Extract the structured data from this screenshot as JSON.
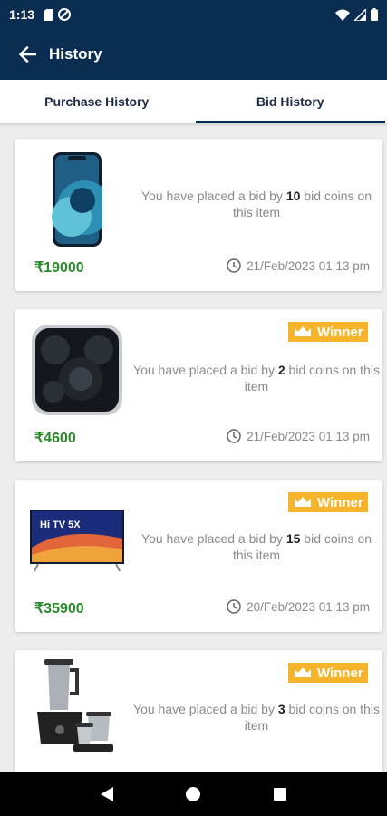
{
  "status_bar": {
    "time": "1:13"
  },
  "app_bar": {
    "title": "History"
  },
  "tabs": [
    {
      "label": "Purchase History",
      "active": false
    },
    {
      "label": "Bid History",
      "active": true
    }
  ],
  "cards": [
    {
      "product": "phone",
      "msg_prefix": "You have placed a bid by ",
      "coins": "10",
      "msg_suffix": " bid coins on this item",
      "price": "₹19000",
      "date": "21/Feb/2023 01:13 pm",
      "winner_label": ""
    },
    {
      "product": "earbuds",
      "msg_prefix": "You have placed a bid by ",
      "coins": "2",
      "msg_suffix": " bid coins on this item",
      "price": "₹4600",
      "date": "21/Feb/2023 01:13 pm",
      "winner_label": "Winner"
    },
    {
      "product": "tv",
      "tv_screen_text": "Hi TV 5X",
      "msg_prefix": "You have placed a bid by ",
      "coins": "15",
      "msg_suffix": " bid coins on this item",
      "price": "₹35900",
      "date": "20/Feb/2023 01:13 pm",
      "winner_label": "Winner"
    },
    {
      "product": "mixer",
      "msg_prefix": "You have placed a bid by ",
      "coins": "3",
      "msg_suffix": " bid coins on this item",
      "price": "",
      "date": "",
      "winner_label": "Winner"
    }
  ],
  "colors": {
    "primary": "#0b2d52",
    "price": "#2a8a2a",
    "winner": "#f5b429"
  }
}
